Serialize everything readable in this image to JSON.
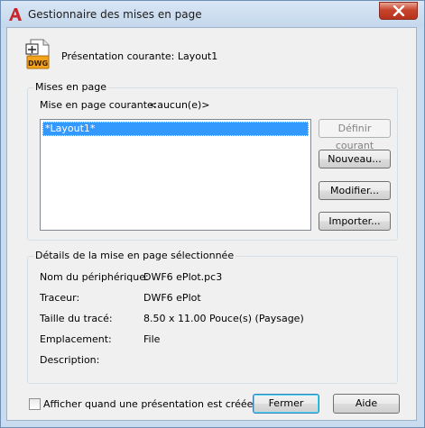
{
  "window": {
    "title": "Gestionnaire des mises en page",
    "app_icon": "autocad-a-icon",
    "close_icon": "close-icon"
  },
  "current_layout": {
    "icon": "dwg-file-icon",
    "icon_text": "DWG",
    "label": "Présentation courante:  Layout1"
  },
  "page_setups": {
    "legend": "Mises en page",
    "current_label": "Mise en page courante:",
    "current_value": "<aucun(e)>",
    "items": [
      "*Layout1*"
    ],
    "selected_index": 0
  },
  "buttons": {
    "set_current": "Définir courant",
    "new": "Nouveau...",
    "modify": "Modifier...",
    "import": "Importer...",
    "close": "Fermer",
    "help": "Aide"
  },
  "details": {
    "legend": "Détails de la mise en page sélectionnée",
    "rows": [
      {
        "label": "Nom du périphérique:",
        "value": "DWF6 ePlot.pc3"
      },
      {
        "label": "Traceur:",
        "value": "DWF6 ePlot"
      },
      {
        "label": "Taille du tracé:",
        "value": "8.50 x 11.00 Pouce(s) (Paysage)"
      },
      {
        "label": "Emplacement:",
        "value": "File"
      },
      {
        "label": "Description:",
        "value": ""
      }
    ]
  },
  "footer": {
    "checkbox_label": "Afficher quand une présentation est créée",
    "checkbox_checked": false
  },
  "colors": {
    "selection": "#3399ff",
    "close_button": "#c7442c",
    "title_bar": "#c9dbee"
  }
}
